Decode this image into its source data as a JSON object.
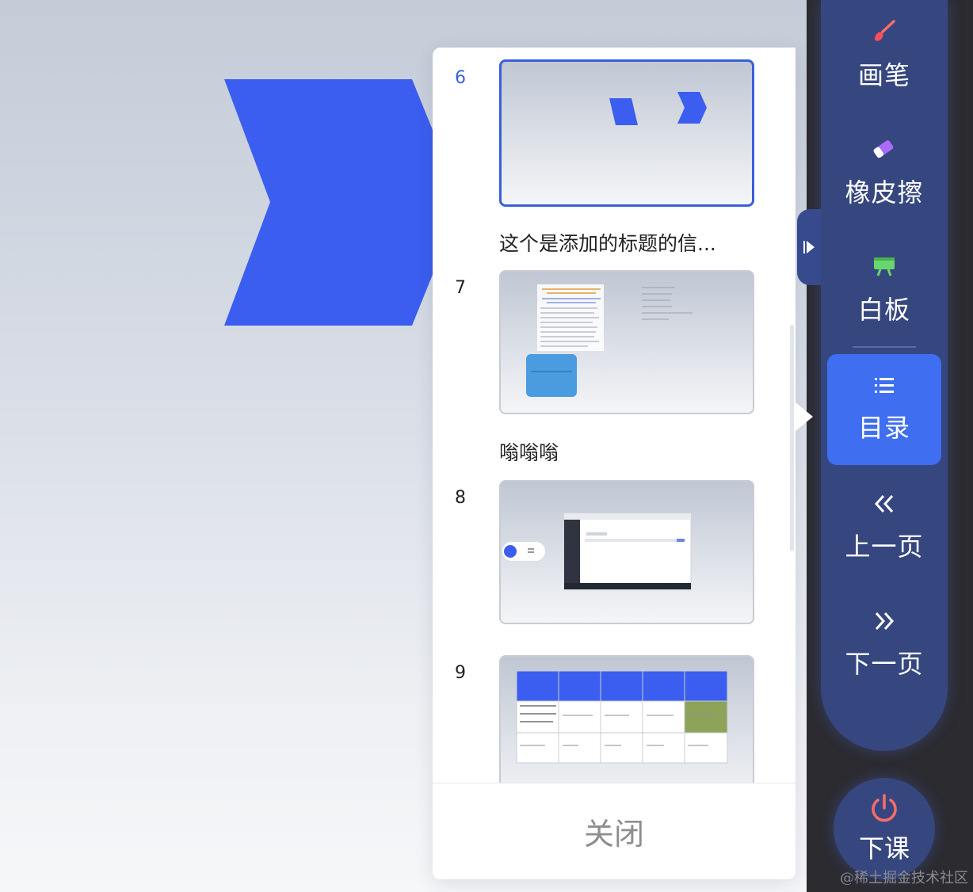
{
  "slide": {
    "shape_color": "#3b5ef0"
  },
  "catalog": {
    "items": [
      {
        "number": "6",
        "title": "这个是添加的标题的信...",
        "active": true
      },
      {
        "number": "7",
        "title": "嗡嗡嗡",
        "active": false
      },
      {
        "number": "8",
        "title": "",
        "active": false
      },
      {
        "number": "9",
        "title": "",
        "active": false
      }
    ],
    "close_label": "关闭"
  },
  "toolbar": {
    "tools": [
      {
        "name": "pen",
        "label": "画笔",
        "icon": "brush-icon"
      },
      {
        "name": "eraser",
        "label": "橡皮擦",
        "icon": "eraser-icon"
      },
      {
        "name": "whiteboard",
        "label": "白板",
        "icon": "whiteboard-icon"
      },
      {
        "name": "catalog",
        "label": "目录",
        "icon": "list-icon",
        "active": true
      },
      {
        "name": "prev",
        "label": "上一页",
        "icon": "double-chevron-left-icon"
      },
      {
        "name": "next",
        "label": "下一页",
        "icon": "double-chevron-right-icon"
      }
    ],
    "end_class_label": "下课",
    "accent_color": "#3f6ef0",
    "panel_color": "#36477f"
  },
  "watermark": "@稀土掘金技术社区"
}
